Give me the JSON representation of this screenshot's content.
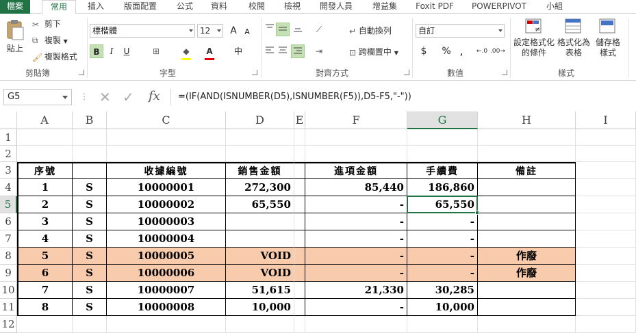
{
  "tabs": [
    "檔案",
    "常用",
    "插入",
    "版面配置",
    "公式",
    "資料",
    "校閱",
    "檢視",
    "開發人員",
    "增益集",
    "Foxit PDF",
    "POWERPIVOT",
    "小組"
  ],
  "ribbon": {
    "clipboard": {
      "paste": "貼上",
      "cut": "剪下",
      "copy": "複製",
      "format_painter": "複製格式",
      "label": "剪貼簿"
    },
    "font": {
      "name": "標楷體",
      "size": "12",
      "bold": "B",
      "italic": "I",
      "underline": "U",
      "grow": "A",
      "shrink": "A",
      "phonetic": "中",
      "label": "字型"
    },
    "alignment": {
      "wrap": "自動換列",
      "merge": "跨欄置中",
      "label": "對齊方式"
    },
    "number": {
      "format": "自訂",
      "currency": "$",
      "percent": "%",
      "comma": ",",
      "label": "數值"
    },
    "styles": {
      "conditional": "設定格式化的條件",
      "table": "格式化為表格",
      "cell": "儲存格樣式",
      "label": "樣式"
    }
  },
  "formula_bar": {
    "name_box": "G5",
    "fx": "fx",
    "formula": "=(IF(AND(ISNUMBER(D5),ISNUMBER(F5)),D5-F5,\"-\"))"
  },
  "columns": [
    "A",
    "B",
    "C",
    "D",
    "E",
    "F",
    "G",
    "H",
    "I"
  ],
  "rows": [
    "1",
    "2",
    "3",
    "4",
    "5",
    "6",
    "7",
    "8",
    "9",
    "10",
    "11",
    "12"
  ],
  "selected_cell": "G5",
  "table": {
    "headers": {
      "A": "序號",
      "C": "收據編號",
      "D": "銷售金額",
      "F": "進項金額",
      "G": "手續費",
      "H": "備註"
    },
    "rows": [
      {
        "A": "1",
        "B": "S",
        "C": "10000001",
        "D": "272,300",
        "F": "85,440",
        "G": "186,860",
        "H": ""
      },
      {
        "A": "2",
        "B": "S",
        "C": "10000002",
        "D": "65,550",
        "F": "-",
        "G": "65,550",
        "H": ""
      },
      {
        "A": "3",
        "B": "S",
        "C": "10000003",
        "D": "",
        "F": "-",
        "G": "-",
        "H": ""
      },
      {
        "A": "4",
        "B": "S",
        "C": "10000004",
        "D": "",
        "F": "-",
        "G": "-",
        "H": ""
      },
      {
        "A": "5",
        "B": "S",
        "C": "10000005",
        "D": "VOID",
        "F": "-",
        "G": "-",
        "H": "作廢"
      },
      {
        "A": "6",
        "B": "S",
        "C": "10000006",
        "D": "VOID",
        "F": "-",
        "G": "-",
        "H": "作廢"
      },
      {
        "A": "7",
        "B": "S",
        "C": "10000007",
        "D": "51,615",
        "F": "21,330",
        "G": "30,285",
        "H": ""
      },
      {
        "A": "8",
        "B": "S",
        "C": "10000008",
        "D": "10,000",
        "F": "-",
        "G": "10,000",
        "H": ""
      }
    ]
  },
  "colors": {
    "accent": "#217346",
    "void_fill": "#f8cbad"
  }
}
